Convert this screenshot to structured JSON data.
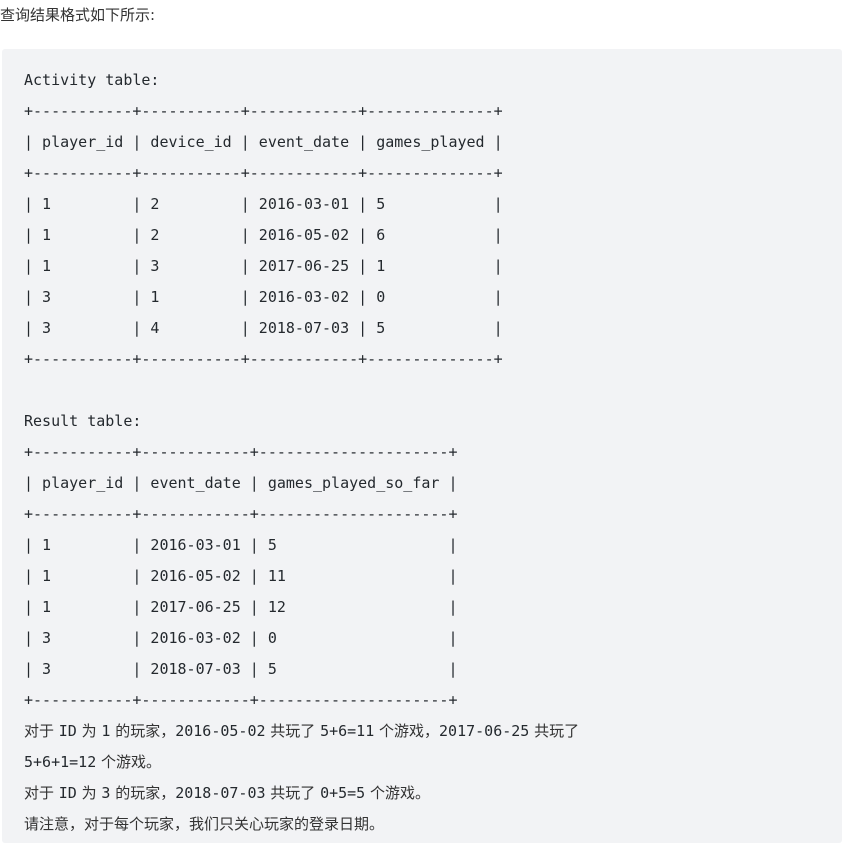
{
  "intro_text": "查询结果格式如下所示:",
  "code_lines": [
    "Activity table:",
    "+-----------+-----------+------------+--------------+",
    "| player_id | device_id | event_date | games_played |",
    "+-----------+-----------+------------+--------------+",
    "| 1         | 2         | 2016-03-01 | 5            |",
    "| 1         | 2         | 2016-05-02 | 6            |",
    "| 1         | 3         | 2017-06-25 | 1            |",
    "| 3         | 1         | 2016-03-02 | 0            |",
    "| 3         | 4         | 2018-07-03 | 5            |",
    "+-----------+-----------+------------+--------------+",
    "",
    "Result table:",
    "+-----------+------------+---------------------+",
    "| player_id | event_date | games_played_so_far |",
    "+-----------+------------+---------------------+",
    "| 1         | 2016-03-01 | 5                   |",
    "| 1         | 2016-05-02 | 11                  |",
    "| 1         | 2017-06-25 | 12                  |",
    "| 3         | 2016-03-02 | 0                   |",
    "| 3         | 2018-07-03 | 5                   |",
    "+-----------+------------+---------------------+"
  ],
  "notes": [
    [
      {
        "t": "对于 ",
        "m": false
      },
      {
        "t": "ID",
        "m": true
      },
      {
        "t": " 为 ",
        "m": false
      },
      {
        "t": "1",
        "m": true
      },
      {
        "t": " 的玩家，",
        "m": false
      },
      {
        "t": "2016-05-02",
        "m": true
      },
      {
        "t": " 共玩了 ",
        "m": false
      },
      {
        "t": "5+6=11",
        "m": true
      },
      {
        "t": " 个游戏，",
        "m": false
      },
      {
        "t": "2017-06-25",
        "m": true
      },
      {
        "t": " 共玩了",
        "m": false
      }
    ],
    [
      {
        "t": "5+6+1=12",
        "m": true
      },
      {
        "t": " 个游戏。",
        "m": false
      }
    ],
    [
      {
        "t": "对于 ",
        "m": false
      },
      {
        "t": "ID",
        "m": true
      },
      {
        "t": " 为 ",
        "m": false
      },
      {
        "t": "3",
        "m": true
      },
      {
        "t": " 的玩家，",
        "m": false
      },
      {
        "t": "2018-07-03",
        "m": true
      },
      {
        "t": " 共玩了 ",
        "m": false
      },
      {
        "t": "0+5=5",
        "m": true
      },
      {
        "t": " 个游戏。",
        "m": false
      }
    ],
    [
      {
        "t": "请注意，对于每个玩家，我们只关心玩家的登录日期。",
        "m": false
      }
    ]
  ]
}
